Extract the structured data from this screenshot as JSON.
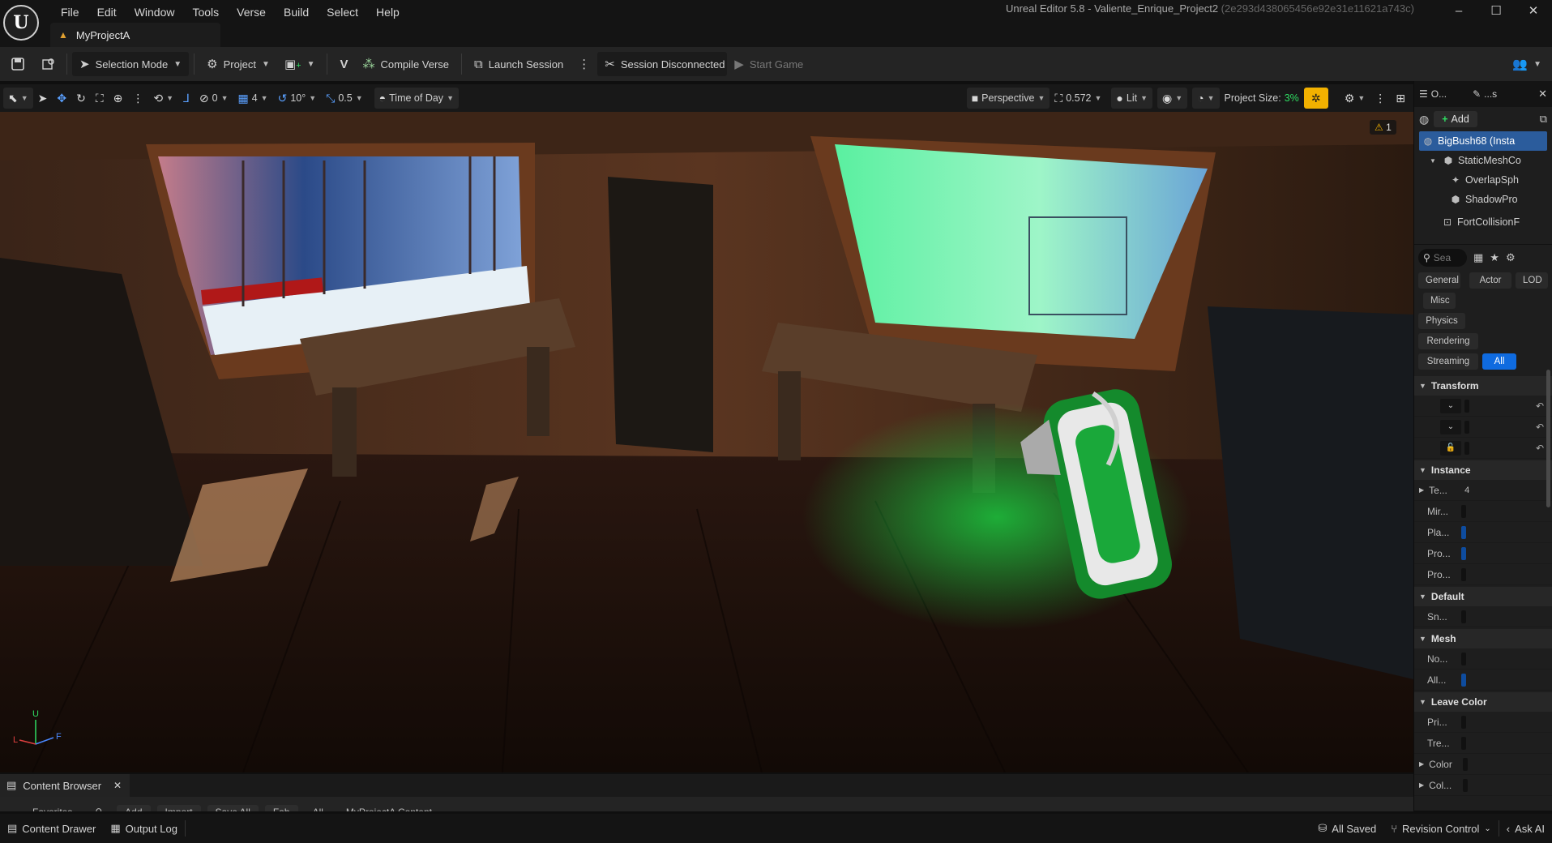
{
  "app": {
    "logo": "ue-logo",
    "menu": [
      "File",
      "Edit",
      "Window",
      "Tools",
      "Verse",
      "Build",
      "Select",
      "Help"
    ],
    "window_title": "Unreal Editor 5.8 - Valiente_Enrique_Project2",
    "window_hash": "(2e293d438065456e92e31e11621a743c)",
    "window_controls": [
      "–",
      "☐",
      "✕"
    ],
    "project_tab": "MyProjectA"
  },
  "toolbar": {
    "selection_mode": "Selection Mode",
    "project": "Project",
    "compile_verse": "Compile Verse",
    "launch_session": "Launch Session",
    "session_status": "Session Disconnected",
    "start_game": "Start Game"
  },
  "viewport_toolbar": {
    "rotation_snap_value": "0",
    "grid_value": "4",
    "angle_value": "10°",
    "scale_value": "0.5",
    "time_of_day": "Time of Day",
    "perspective": "Perspective",
    "camera_speed": "0.572",
    "view_mode": "Lit",
    "project_size_label": "Project Size:",
    "project_size_value": "3%"
  },
  "viewport": {
    "warning_count": "1",
    "axis_labels": {
      "up": "U",
      "left": "L",
      "forward": "F"
    }
  },
  "right_panel": {
    "tabs": {
      "outliner": "O...",
      "details": "...s"
    },
    "add_label": "Add",
    "components": [
      {
        "label": "BigBush68 (Insta",
        "selected": true,
        "indent": 0,
        "icon": "actor-icon"
      },
      {
        "label": "StaticMeshCo",
        "selected": false,
        "indent": 1,
        "icon": "static-mesh-icon"
      },
      {
        "label": "OverlapSph",
        "selected": false,
        "indent": 2,
        "icon": "sphere-collision-icon"
      },
      {
        "label": "ShadowPro",
        "selected": false,
        "indent": 2,
        "icon": "static-mesh-icon"
      },
      {
        "label": "FortCollisionF",
        "selected": false,
        "indent": 1,
        "icon": "component-icon"
      }
    ],
    "search_placeholder": "Sea",
    "filters": [
      {
        "label": "General",
        "active": false
      },
      {
        "label": "Actor",
        "active": false
      },
      {
        "label": "LOD",
        "active": false
      },
      {
        "label": "Misc",
        "active": false
      },
      {
        "label": "Physics",
        "active": false
      },
      {
        "label": "Rendering",
        "active": false
      },
      {
        "label": "Streaming",
        "active": false
      },
      {
        "label": "All",
        "active": true
      }
    ],
    "sections": {
      "transform": "Transform",
      "instance": "Instance",
      "default": "Default",
      "mesh": "Mesh",
      "leave_color": "Leave Color"
    },
    "instance_props": [
      "Te...",
      "Mir...",
      "Pla...",
      "Pro...",
      "Pro..."
    ],
    "instance_te_value": "4",
    "default_props": [
      "Sn..."
    ],
    "mesh_props": [
      "No...",
      "All..."
    ],
    "leave_color_props": [
      "Pri...",
      "Tre...",
      "Color",
      "Col..."
    ]
  },
  "content_browser": {
    "tab_label": "Content Browser",
    "toolbar_items": [
      "Favorites",
      "Add",
      "Import",
      "Save All",
      "Fab",
      "All",
      "MyProjectA Content"
    ]
  },
  "statusbar": {
    "content_drawer": "Content Drawer",
    "output_log": "Output Log",
    "all_saved": "All Saved",
    "revision_control": "Revision Control",
    "ask_ai": "Ask AI"
  },
  "colors": {
    "accent_blue": "#0f6be0",
    "selection_blue": "#2b5c9c",
    "project_size_green": "#2fdc62",
    "warning_yellow": "#f2b100",
    "speaker_green": "#1dbe3c"
  }
}
